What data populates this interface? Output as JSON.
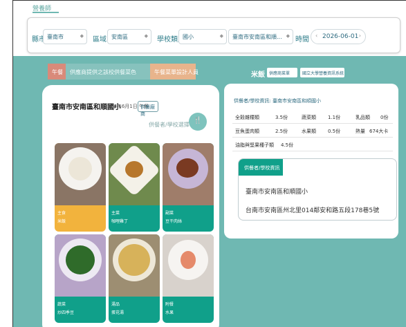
{
  "top": {
    "label": "營養師"
  },
  "filters": {
    "city_label": "縣市",
    "city_value": "臺南市",
    "district_label": "區域",
    "district_value": "安南區",
    "school_label": "學校類別",
    "school_type_value": "國小",
    "school_value": "臺南市安南區和順...",
    "date_label": "時間",
    "date_value": "2026-06-01",
    "date_prev": "‹",
    "date_next": "›"
  },
  "tabs": [
    {
      "label": "午餐"
    },
    {
      "label": "供應商提供之該校供餐菜色"
    },
    {
      "label": "午餐菜單設計人員"
    }
  ],
  "school": {
    "name": "臺南市安南區和順國小",
    "date": "2026年6月1日 午餐",
    "supplier_button": "供餐廠商",
    "switch_label": "供餐者/學校選擇",
    "switch_icon": "fork-icon"
  },
  "dishes": [
    {
      "type": "主食",
      "name": "米飯",
      "highlight": true
    },
    {
      "type": "主菜",
      "name": "咖哩雞丁",
      "highlight": false
    },
    {
      "type": "副菜",
      "name": "豆干肉絲",
      "highlight": false
    },
    {
      "type": "蔬菜",
      "name": "炒四季豆",
      "highlight": false
    },
    {
      "type": "湯品",
      "name": "蛋花湯",
      "highlight": false
    },
    {
      "type": "附餐",
      "name": "水果",
      "highlight": false
    }
  ],
  "menu": {
    "title": "米飯",
    "select1": "供應商菜單",
    "select2": "國立大學營養資訊系統"
  },
  "info": {
    "title": "供餐者/學校資訊: 臺南市安南區和順國小",
    "rows": [
      [
        "全穀雜糧類",
        "3.5份",
        "蔬菜類",
        "1.1份",
        "乳品類",
        "0份"
      ],
      [
        "豆魚蛋肉類",
        "2.5份",
        "水果類",
        "0.5份",
        "熱量",
        "674大卡"
      ],
      [
        "油脂與堅果種子類",
        "4.5份",
        "",
        "",
        "",
        ""
      ]
    ]
  },
  "supplier": {
    "head": "供餐者/學校資訊",
    "name": "臺南市安南區和順國小",
    "address": "台南市安南區州北里014鄰安和路五段178巷5號"
  }
}
